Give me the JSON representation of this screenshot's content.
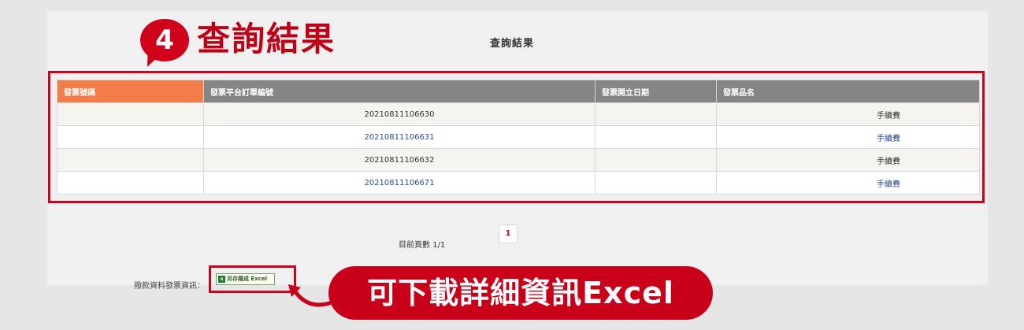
{
  "step_badge": {
    "number": "4",
    "title": "查詢結果"
  },
  "page": {
    "title": "查詢結果"
  },
  "table": {
    "headers": [
      "發票號碼",
      "發票平台訂單編號",
      "發票開立日期",
      "發票品名"
    ],
    "rows": [
      [
        "",
        "20210811106630",
        "",
        "手續費"
      ],
      [
        "",
        "20210811106631",
        "",
        "手續費"
      ],
      [
        "",
        "20210811106632",
        "",
        "手續費"
      ],
      [
        "",
        "20210811106671",
        "",
        "手續費"
      ]
    ]
  },
  "pagination": {
    "info": "目前頁數 1/1",
    "current_page": "1"
  },
  "export": {
    "label": "撥款資料發票資訊：",
    "button_label": "另存檔成 Excel",
    "icon": "excel-icon"
  },
  "callout": {
    "text": "可下載詳細資訊Excel"
  },
  "colors": {
    "accent_red": "#d0021b",
    "header_orange": "#f47c48",
    "header_gray": "#858585"
  }
}
